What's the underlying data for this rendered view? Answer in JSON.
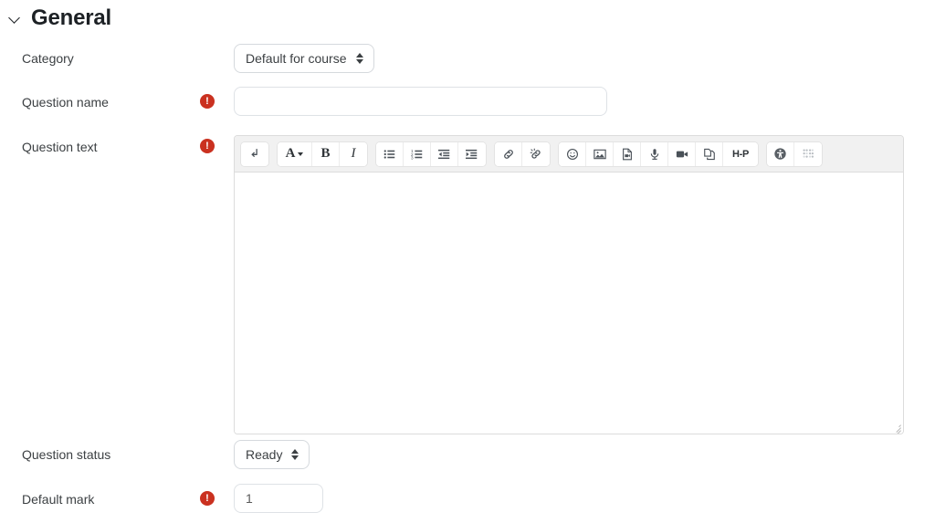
{
  "section": {
    "title": "General",
    "collapse_icon": "chevron-down-icon"
  },
  "fields": {
    "category": {
      "label": "Category",
      "value": "Default for course",
      "required": false
    },
    "question_name": {
      "label": "Question name",
      "value": "",
      "placeholder": "",
      "required": true
    },
    "question_text": {
      "label": "Question text",
      "value": "",
      "placeholder": "",
      "required": true
    },
    "question_status": {
      "label": "Question status",
      "value": "Ready",
      "required": false
    },
    "default_mark": {
      "label": "Default mark",
      "value": "1",
      "required": true
    }
  },
  "editor": {
    "toolbar_groups": [
      {
        "name": "formatting",
        "buttons": [
          {
            "name": "line-break-icon",
            "title": "Insert line break",
            "glyph": "linebreak"
          },
          {
            "name": "text-style-icon",
            "title": "Styles",
            "glyph": "A-caret"
          },
          {
            "name": "bold-icon",
            "title": "Bold",
            "glyph": "B"
          },
          {
            "name": "italic-icon",
            "title": "Italic",
            "glyph": "I"
          }
        ]
      },
      {
        "name": "lists-indent",
        "buttons": [
          {
            "name": "bullet-list-icon",
            "title": "Bulleted list",
            "glyph": "ul"
          },
          {
            "name": "numbered-list-icon",
            "title": "Numbered list",
            "glyph": "ol"
          },
          {
            "name": "outdent-icon",
            "title": "Decrease indent",
            "glyph": "outdent"
          },
          {
            "name": "indent-icon",
            "title": "Increase indent",
            "glyph": "indent"
          }
        ]
      },
      {
        "name": "links",
        "buttons": [
          {
            "name": "link-icon",
            "title": "Insert link",
            "glyph": "link"
          },
          {
            "name": "unlink-icon",
            "title": "Remove link",
            "glyph": "unlink"
          }
        ]
      },
      {
        "name": "media",
        "buttons": [
          {
            "name": "emoticon-icon",
            "title": "Emojis",
            "glyph": "smiley"
          },
          {
            "name": "image-icon",
            "title": "Image",
            "glyph": "image"
          },
          {
            "name": "media-file-icon",
            "title": "Multimedia",
            "glyph": "mediafile"
          },
          {
            "name": "microphone-icon",
            "title": "Record audio",
            "glyph": "mic"
          },
          {
            "name": "video-camera-icon",
            "title": "Record video",
            "glyph": "video"
          },
          {
            "name": "manage-files-icon",
            "title": "Manage files",
            "glyph": "files"
          },
          {
            "name": "h5p-icon",
            "title": "Insert H5P",
            "glyph": "h5p"
          }
        ]
      },
      {
        "name": "accessibility",
        "buttons": [
          {
            "name": "accessibility-checker-icon",
            "title": "Accessibility checker",
            "glyph": "a11y"
          },
          {
            "name": "screenreader-helper-icon",
            "title": "Screenreader helper",
            "glyph": "braille"
          }
        ]
      }
    ]
  },
  "colors": {
    "required_badge": "#ca3120",
    "toolbar_bg": "#f1f1f1",
    "text": "#3c4043",
    "heading": "#1d2125",
    "border": "#dcdcdc"
  }
}
